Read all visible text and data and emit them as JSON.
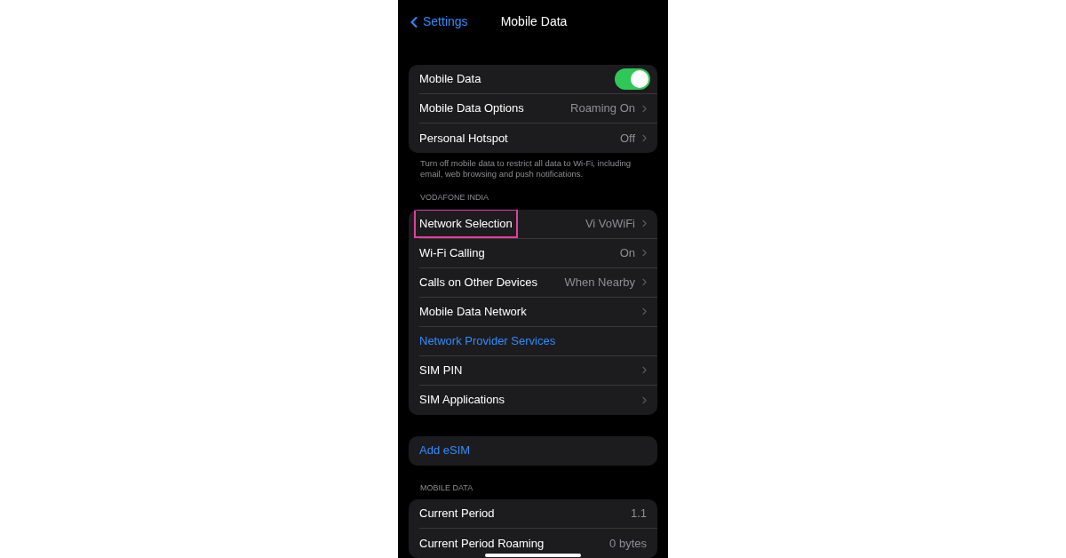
{
  "nav": {
    "back": "Settings",
    "title": "Mobile Data"
  },
  "sections": [
    {
      "rows": [
        {
          "kind": "toggle",
          "label": "Mobile Data",
          "on": true,
          "highlighted": false
        },
        {
          "kind": "detail",
          "label": "Mobile Data Options",
          "value": "Roaming On",
          "highlighted": false
        },
        {
          "kind": "detail",
          "label": "Personal Hotspot",
          "value": "Off",
          "highlighted": false
        }
      ],
      "footer": "Turn off mobile data to restrict all data to Wi-Fi, including email, web browsing and push notifications."
    },
    {
      "header": "VODAFONE INDIA",
      "rows": [
        {
          "kind": "detail",
          "label": "Network Selection",
          "value": "Vi VoWiFi",
          "highlighted": true
        },
        {
          "kind": "detail",
          "label": "Wi-Fi Calling",
          "value": "On",
          "highlighted": false
        },
        {
          "kind": "detail",
          "label": "Calls on Other Devices",
          "value": "When Nearby",
          "highlighted": false
        },
        {
          "kind": "detail",
          "label": "Mobile Data Network",
          "highlighted": false
        },
        {
          "kind": "link",
          "label": "Network Provider Services",
          "highlighted": false
        },
        {
          "kind": "detail",
          "label": "SIM PIN",
          "highlighted": false
        },
        {
          "kind": "detail",
          "label": "SIM Applications",
          "highlighted": false
        }
      ]
    },
    {
      "rows": [
        {
          "kind": "link",
          "label": "Add eSIM",
          "highlighted": false
        }
      ]
    },
    {
      "header": "MOBILE DATA",
      "rows": [
        {
          "kind": "value",
          "label": "Current Period",
          "value": "1.1",
          "highlighted": false
        },
        {
          "kind": "value",
          "label": "Current Period Roaming",
          "value": "0 bytes",
          "highlighted": false
        }
      ]
    }
  ]
}
